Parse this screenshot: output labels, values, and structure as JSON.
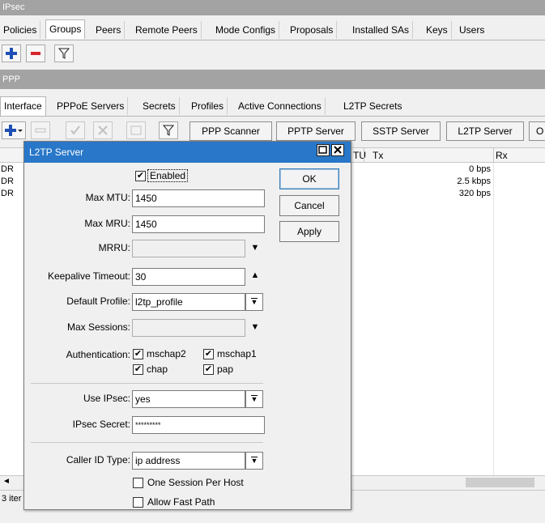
{
  "ipsec_window": {
    "title": "IPsec",
    "tabs": [
      "Policies",
      "Groups",
      "Peers",
      "Remote Peers",
      "Mode Configs",
      "Proposals",
      "Installed SAs",
      "Keys",
      "Users"
    ],
    "active_tab": "Groups"
  },
  "ppp_window": {
    "title": "PPP",
    "tabs": [
      "Interface",
      "PPPoE Servers",
      "Secrets",
      "Profiles",
      "Active Connections",
      "L2TP Secrets"
    ],
    "active_tab": "Interface",
    "toolbar_buttons": [
      "PPP Scanner",
      "PPTP Server",
      "SSTP Server",
      "L2TP Server",
      "O"
    ],
    "columns": [
      "TU",
      "Tx",
      "Rx"
    ],
    "rows": [
      {
        "name": "DR",
        "tx": "0 bps"
      },
      {
        "name": "DR",
        "tx": "2.5 kbps"
      },
      {
        "name": "DR",
        "tx": "320 bps"
      }
    ],
    "status": "3 iter"
  },
  "dialog": {
    "title": "L2TP Server",
    "enabled_label": "Enabled",
    "enabled": true,
    "max_mtu_label": "Max MTU:",
    "max_mtu": "1450",
    "max_mru_label": "Max MRU:",
    "max_mru": "1450",
    "mrru_label": "MRRU:",
    "mrru": "",
    "keepalive_label": "Keepalive Timeout:",
    "keepalive": "30",
    "default_profile_label": "Default Profile:",
    "default_profile": "l2tp_profile",
    "max_sessions_label": "Max Sessions:",
    "max_sessions": "",
    "authentication_label": "Authentication:",
    "auth": {
      "mschap2": "mschap2",
      "mschap1": "mschap1",
      "chap": "chap",
      "pap": "pap"
    },
    "use_ipsec_label": "Use IPsec:",
    "use_ipsec": "yes",
    "ipsec_secret_label": "IPsec Secret:",
    "ipsec_secret": "*********",
    "caller_id_label": "Caller ID Type:",
    "caller_id": "ip address",
    "one_session_label": "One Session Per Host",
    "allow_fast_path_label": "Allow Fast Path",
    "ok": "OK",
    "cancel": "Cancel",
    "apply": "Apply"
  },
  "colors": {
    "title_bar": "#a3a3a3",
    "dialog_title": "#2877c8",
    "add_icon": "#1e4fb5",
    "remove_icon": "#d9262d"
  }
}
